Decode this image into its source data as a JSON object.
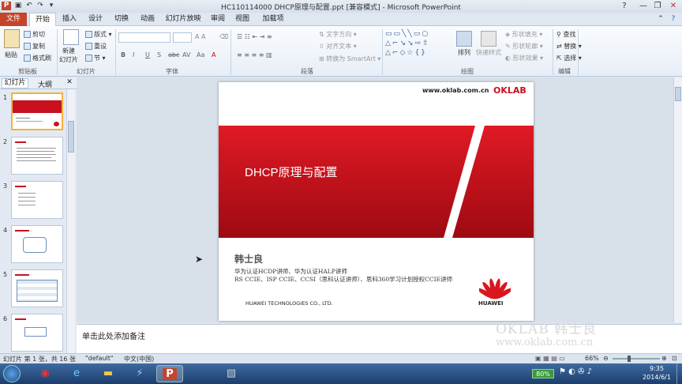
{
  "window": {
    "title": "HC110114000 DHCP原理与配置.ppt [兼容模式] - Microsoft PowerPoint",
    "controls": [
      "?",
      "—",
      "❐",
      "✕"
    ]
  },
  "tabs": [
    {
      "label": "文件"
    },
    {
      "label": "开始"
    },
    {
      "label": "插入"
    },
    {
      "label": "设计"
    },
    {
      "label": "切换"
    },
    {
      "label": "动画"
    },
    {
      "label": "幻灯片放映"
    },
    {
      "label": "审阅"
    },
    {
      "label": "视图"
    },
    {
      "label": "加载项"
    }
  ],
  "ribbon": {
    "clipboard": {
      "paste": "粘贴",
      "cut": "剪切",
      "copy": "复制",
      "format_painter": "格式刷",
      "label": "剪贴板"
    },
    "slides": {
      "new_slide_line1": "新建",
      "new_slide_line2": "幻灯片",
      "layout": "版式",
      "reset": "重设",
      "section": "节",
      "label": "幻灯片"
    },
    "font": {
      "label": "字体"
    },
    "paragraph": {
      "text_direction": "文字方向",
      "align_text": "对齐文本",
      "convert_smartart": "转换为 SmartArt",
      "label": "段落"
    },
    "drawing": {
      "arrange": "排列",
      "quick_styles": "快速样式",
      "shape_fill": "形状填充",
      "shape_outline": "形状轮廓",
      "shape_effects": "形状效果",
      "label": "绘图"
    },
    "editing": {
      "find": "查找",
      "replace": "替换",
      "select": "选择",
      "label": "编辑"
    }
  },
  "panel": {
    "tab_slides": "幻灯片",
    "tab_outline": "大纲",
    "close": "✕",
    "thumbnails": [
      "1",
      "2",
      "3",
      "4",
      "5",
      "6"
    ]
  },
  "slide": {
    "website": "www.oklab.com.cn",
    "logo": "OKLAB",
    "title": "DHCP原理与配置",
    "author": "韩士良",
    "line1": "华为认证HCDP讲师、华为认证HALP讲师",
    "line2": "RS CCIE、ISP CCIE、CCSI（思科认证讲师）、思科360学习计划授权CCIE讲师",
    "company": "HUAWEI TECHNOLOGIES   CO., LTD.",
    "brand": "HUAWEI"
  },
  "watermark": {
    "line1": "OKLAB 韩士良",
    "line2": "www.oklab.com.cn"
  },
  "notes": {
    "placeholder": "单击此处添加备注"
  },
  "status": {
    "slide_info": "幻灯片 第 1 张，共 16 张",
    "theme": "\"default\"",
    "language": "中文(中国)",
    "zoom": "66%"
  },
  "taskbar": {
    "battery": "80%",
    "time": "9:35",
    "date": "2014/6/1"
  },
  "colors": {
    "accent": "#c4452c",
    "slide_red": "#c8101e",
    "ribbon_bg": "#e7eef7"
  }
}
